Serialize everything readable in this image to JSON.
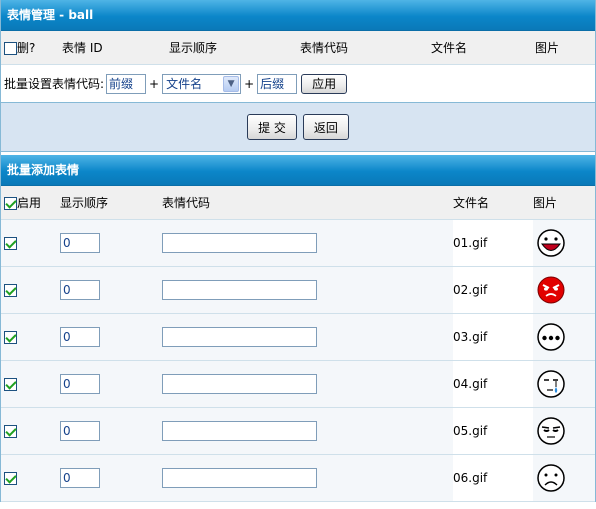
{
  "header": {
    "title": "表情管理 - ball"
  },
  "list_columns": {
    "delete": "删?",
    "id": "表情 ID",
    "order": "显示顺序",
    "code": "表情代码",
    "filename": "文件名",
    "image": "图片"
  },
  "batch": {
    "label": "批量设置表情代码:",
    "prefix_value": "前缀",
    "plus1": "+",
    "select_value": "文件名",
    "plus2": "+",
    "suffix_value": "后缀",
    "apply_label": "应用"
  },
  "actions": {
    "submit_label": "提 交",
    "back_label": "返回"
  },
  "add_section": {
    "title": "批量添加表情",
    "columns": {
      "enable": "启用",
      "order": "显示顺序",
      "code": "表情代码",
      "filename": "文件名",
      "image": "图片"
    },
    "rows": [
      {
        "enabled": true,
        "order": "0",
        "code": "",
        "filename": "01.gif",
        "face": "red-open-mouth-face-icon"
      },
      {
        "enabled": true,
        "order": "0",
        "code": "",
        "filename": "02.gif",
        "face": "red-angry-face-icon"
      },
      {
        "enabled": true,
        "order": "0",
        "code": "",
        "filename": "03.gif",
        "face": "dots-face-icon"
      },
      {
        "enabled": true,
        "order": "0",
        "code": "",
        "filename": "04.gif",
        "face": "crying-face-icon"
      },
      {
        "enabled": true,
        "order": "0",
        "code": "",
        "filename": "05.gif",
        "face": "sleepy-face-icon"
      },
      {
        "enabled": true,
        "order": "0",
        "code": "",
        "filename": "06.gif",
        "face": "sad-face-icon"
      }
    ]
  },
  "colors": {
    "header_blue": "#0b86c9",
    "band_blue": "#d7e4f2",
    "border_blue": "#86b9d6"
  }
}
